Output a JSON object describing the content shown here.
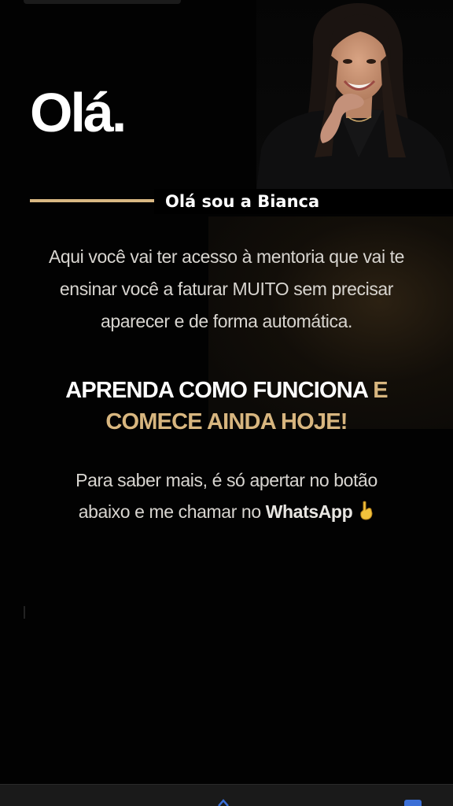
{
  "hero": {
    "greeting": "Olá.",
    "name_label": "Olá sou a Bianca",
    "accent_color": "#d8b67f"
  },
  "intro": {
    "line1": "Aqui você vai ter acesso à mentoria que vai te",
    "line2": "ensinar você a faturar MUITO sem precisar",
    "line3": "aparecer e de forma automática."
  },
  "cta": {
    "white_text": "APRENDA COMO FUNCIONA ",
    "gold_text_1": "E",
    "gold_text_2": "COMECE AINDA HOJE!"
  },
  "more": {
    "line1": "Para saber mais, é só apertar no botão",
    "line2_prefix": "abaixo e me chamar no ",
    "line2_bold": "WhatsApp",
    "icon": "pointing-down-hand-icon"
  },
  "browser": {
    "nav_icons": [
      "up-arrow-icon",
      "tabs-icon"
    ]
  }
}
